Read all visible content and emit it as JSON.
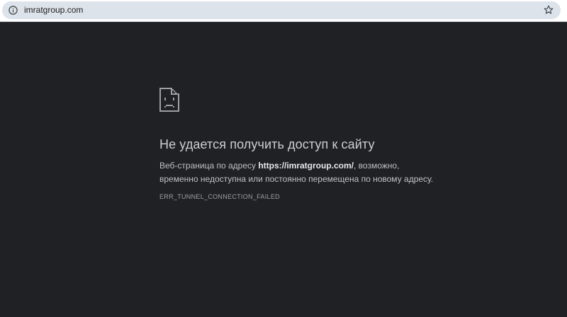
{
  "browser": {
    "url": "imratgroup.com",
    "info_icon": "info-circle-icon",
    "bookmark_icon": "star-outline-icon"
  },
  "error": {
    "icon": "sad-page-icon",
    "title": "Не удается получить доступ к сайту",
    "description_before": "Веб-страница по адресу ",
    "description_url": "https://imratgroup.com/",
    "description_after": ", возможно, временно недоступна или постоянно перемещена по новому адресу.",
    "code": "ERR_TUNNEL_CONNECTION_FAILED"
  },
  "colors": {
    "page_background": "#202124",
    "omnibox_background": "#dde3ea",
    "title_text": "#e8eaed",
    "body_text": "#bdc1c6",
    "code_text": "#9aa0a6"
  }
}
